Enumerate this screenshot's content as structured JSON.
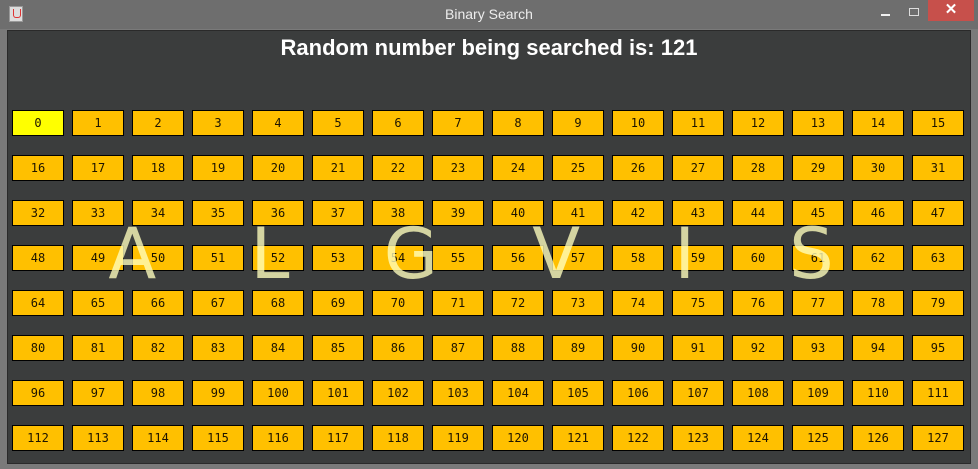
{
  "window": {
    "title": "Binary Search",
    "close_glyph": "✕"
  },
  "heading": "Random number being searched is: 121",
  "watermark": "A L G V I S",
  "colors": {
    "cell": "#ffc000",
    "current_cell": "#ffff00",
    "background": "#3b3d3d"
  },
  "current_index": 0,
  "cells": [
    "0",
    "1",
    "2",
    "3",
    "4",
    "5",
    "6",
    "7",
    "8",
    "9",
    "10",
    "11",
    "12",
    "13",
    "14",
    "15",
    "16",
    "17",
    "18",
    "19",
    "20",
    "21",
    "22",
    "23",
    "24",
    "25",
    "26",
    "27",
    "28",
    "29",
    "30",
    "31",
    "32",
    "33",
    "34",
    "35",
    "36",
    "37",
    "38",
    "39",
    "40",
    "41",
    "42",
    "43",
    "44",
    "45",
    "46",
    "47",
    "48",
    "49",
    "50",
    "51",
    "52",
    "53",
    "54",
    "55",
    "56",
    "57",
    "58",
    "59",
    "60",
    "61",
    "62",
    "63",
    "64",
    "65",
    "66",
    "67",
    "68",
    "69",
    "70",
    "71",
    "72",
    "73",
    "74",
    "75",
    "76",
    "77",
    "78",
    "79",
    "80",
    "81",
    "82",
    "83",
    "84",
    "85",
    "86",
    "87",
    "88",
    "89",
    "90",
    "91",
    "92",
    "93",
    "94",
    "95",
    "96",
    "97",
    "98",
    "99",
    "100",
    "101",
    "102",
    "103",
    "104",
    "105",
    "106",
    "107",
    "108",
    "109",
    "110",
    "111",
    "112",
    "113",
    "114",
    "115",
    "116",
    "117",
    "118",
    "119",
    "120",
    "121",
    "122",
    "123",
    "124",
    "125",
    "126",
    "127"
  ]
}
